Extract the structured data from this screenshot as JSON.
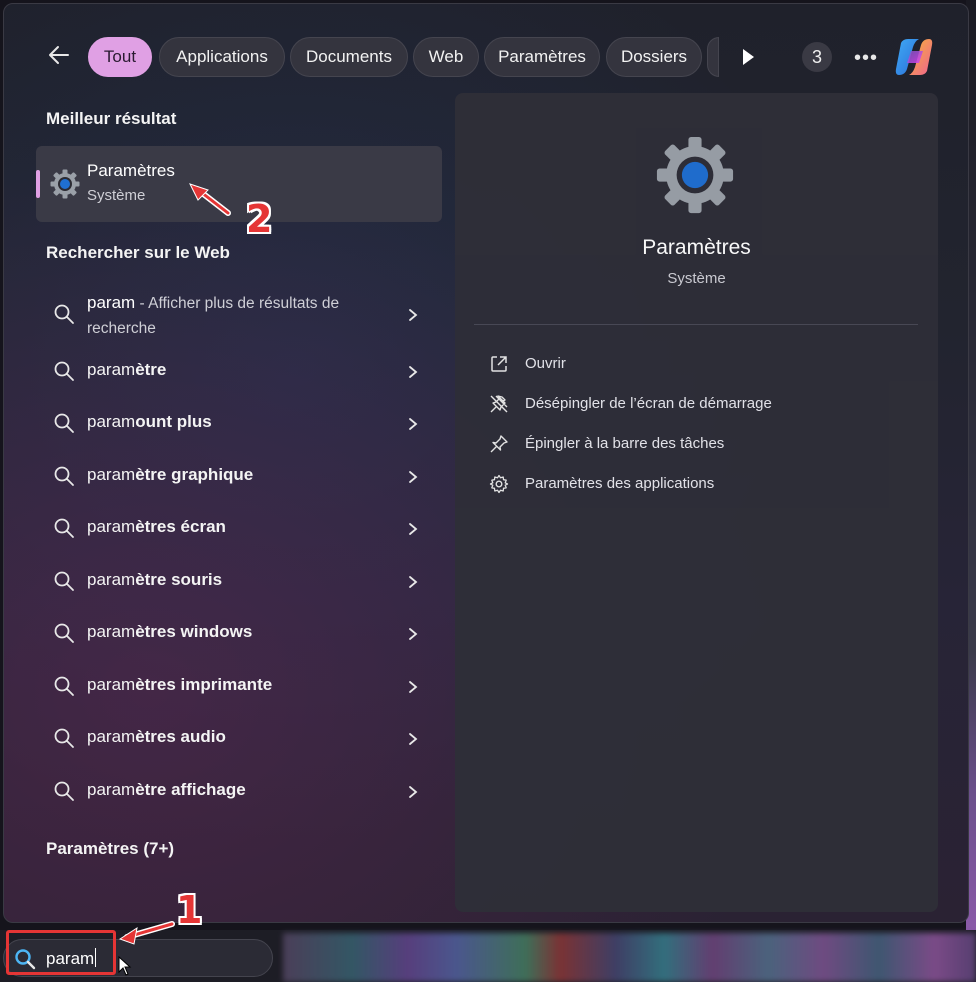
{
  "topbar": {
    "tabs": [
      {
        "label": "Tout",
        "active": true
      },
      {
        "label": "Applications",
        "active": false
      },
      {
        "label": "Documents",
        "active": false
      },
      {
        "label": "Web",
        "active": false
      },
      {
        "label": "Paramètres",
        "active": false
      },
      {
        "label": "Dossiers",
        "active": false
      }
    ],
    "badge_count": "3",
    "more_label": "•••"
  },
  "best": {
    "heading": "Meilleur résultat",
    "title": "Paramètres",
    "subtitle": "Système"
  },
  "web": {
    "heading": "Rechercher sur le Web",
    "first_query": "param",
    "first_rest": " - Afficher plus de résultats de recherche",
    "items": [
      {
        "match": "param",
        "rest": "ètre"
      },
      {
        "match": "param",
        "rest": "ount plus"
      },
      {
        "match": "param",
        "rest": "ètre graphique"
      },
      {
        "match": "param",
        "rest": "ètres écran"
      },
      {
        "match": "param",
        "rest": "ètre souris"
      },
      {
        "match": "param",
        "rest": "ètres windows"
      },
      {
        "match": "param",
        "rest": "ètres imprimante"
      },
      {
        "match": "param",
        "rest": "ètres audio"
      },
      {
        "match": "param",
        "rest": "ètre affichage"
      }
    ]
  },
  "more_section": {
    "label": "Paramètres (7+)"
  },
  "detail": {
    "title": "Paramètres",
    "subtitle": "Système",
    "actions": [
      {
        "label": "Ouvrir",
        "icon": "open-external-icon"
      },
      {
        "label": "Désépingler de l’écran de démarrage",
        "icon": "unpin-icon"
      },
      {
        "label": "Épingler à la barre des tâches",
        "icon": "pin-icon"
      },
      {
        "label": "Paramètres des applications",
        "icon": "gear-icon"
      }
    ]
  },
  "taskbar": {
    "search_value": "param"
  },
  "annotations": {
    "step1": "1",
    "step2": "2"
  },
  "colors": {
    "accent": "#e0a0e4",
    "annotation": "#e53535"
  }
}
